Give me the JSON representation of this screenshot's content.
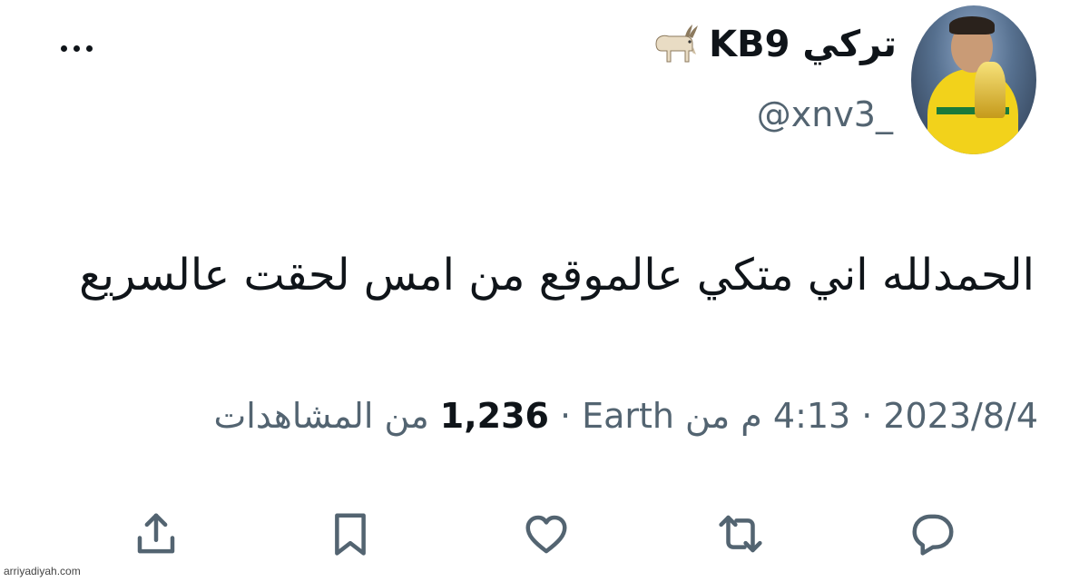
{
  "user": {
    "display_name": "تركي KB9",
    "emoji_icon": "goat-icon",
    "handle": "@xnv3_",
    "avatar_icon": "avatar-image"
  },
  "tweet": {
    "text": "الحمدلله اني متكي عالموقع من امس لحقت عالسريع",
    "date": "2023/8/4",
    "time": "4:13 م",
    "location_prefix": "من",
    "location": "Earth",
    "views_count": "1,236",
    "views_label": "من المشاهدات",
    "separator": "·"
  },
  "actions": [
    {
      "name": "reply",
      "icon": "reply-icon"
    },
    {
      "name": "retweet",
      "icon": "retweet-icon"
    },
    {
      "name": "like",
      "icon": "heart-icon"
    },
    {
      "name": "bookmark",
      "icon": "bookmark-icon"
    },
    {
      "name": "share",
      "icon": "share-icon"
    }
  ],
  "watermark": "arriyadiyah.com",
  "colors": {
    "text_primary": "#0f1419",
    "text_secondary": "#536471",
    "background": "#ffffff"
  }
}
